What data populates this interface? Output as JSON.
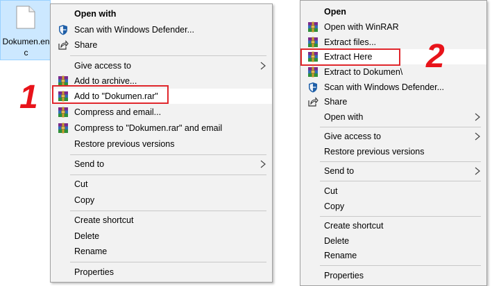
{
  "file": {
    "name": "Dokumen.enc",
    "icon": "blank-document-icon"
  },
  "steps": {
    "one": "1",
    "two": "2"
  },
  "colors": {
    "highlight_border": "#e0262b",
    "step_number": "#e8131a",
    "menu_bg": "#f2f2f2",
    "selection_bg": "#cce8ff"
  },
  "menu1": {
    "open_with": "Open with",
    "scan_defender": "Scan with Windows Defender...",
    "share": "Share",
    "give_access": "Give access to",
    "add_archive": "Add to archive...",
    "add_rar": "Add to \"Dokumen.rar\"",
    "compress_email": "Compress and email...",
    "compress_rar_email": "Compress to \"Dokumen.rar\" and email",
    "restore": "Restore previous versions",
    "send_to": "Send to",
    "cut": "Cut",
    "copy": "Copy",
    "create_shortcut": "Create shortcut",
    "delete": "Delete",
    "rename": "Rename",
    "properties": "Properties"
  },
  "menu2": {
    "open": "Open",
    "open_winrar": "Open with WinRAR",
    "extract_files": "Extract files...",
    "extract_here": "Extract Here",
    "extract_to": "Extract to Dokumen\\",
    "scan_defender": "Scan with Windows Defender...",
    "share": "Share",
    "open_with": "Open with",
    "give_access": "Give access to",
    "restore": "Restore previous versions",
    "send_to": "Send to",
    "cut": "Cut",
    "copy": "Copy",
    "create_shortcut": "Create shortcut",
    "delete": "Delete",
    "rename": "Rename",
    "properties": "Properties"
  }
}
